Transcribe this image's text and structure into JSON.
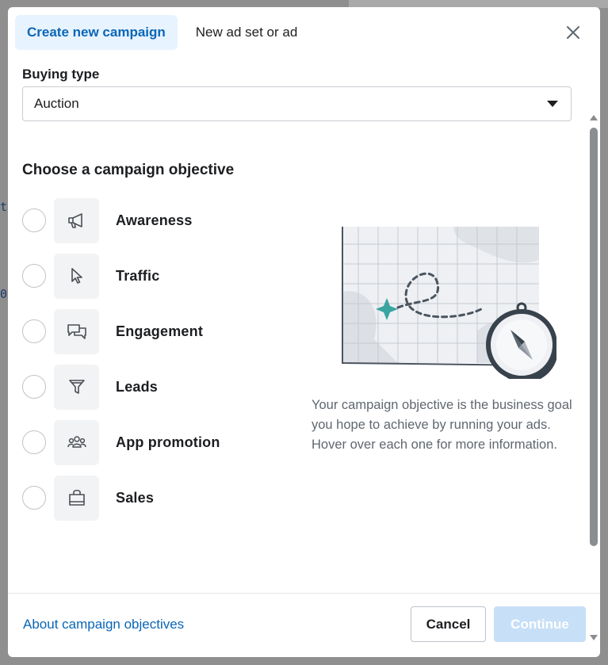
{
  "tabs": [
    {
      "label": "Create new campaign",
      "active": true
    },
    {
      "label": "New ad set or ad",
      "active": false
    }
  ],
  "buying_type": {
    "label": "Buying type",
    "value": "Auction"
  },
  "objective_section": {
    "title": "Choose a campaign objective"
  },
  "objectives": [
    {
      "label": "Awareness",
      "icon": "megaphone-icon",
      "selected": false
    },
    {
      "label": "Traffic",
      "icon": "cursor-icon",
      "selected": false
    },
    {
      "label": "Engagement",
      "icon": "chat-bubbles-icon",
      "selected": false
    },
    {
      "label": "Leads",
      "icon": "funnel-icon",
      "selected": false
    },
    {
      "label": "App promotion",
      "icon": "people-icon",
      "selected": false
    },
    {
      "label": "Sales",
      "icon": "shopping-bag-icon",
      "selected": false
    }
  ],
  "description": "Your campaign objective is the business goal you hope to achieve by running your ads. Hover over each one for more information.",
  "footer": {
    "about_link": "About campaign objectives",
    "cancel_label": "Cancel",
    "continue_label": "Continue",
    "continue_enabled": false
  },
  "colors": {
    "accent": "#0a66b7",
    "tab_active_bg": "#e7f3ff",
    "continue_disabled_bg": "#c7dff7",
    "map_marker": "#3aa5a0"
  }
}
